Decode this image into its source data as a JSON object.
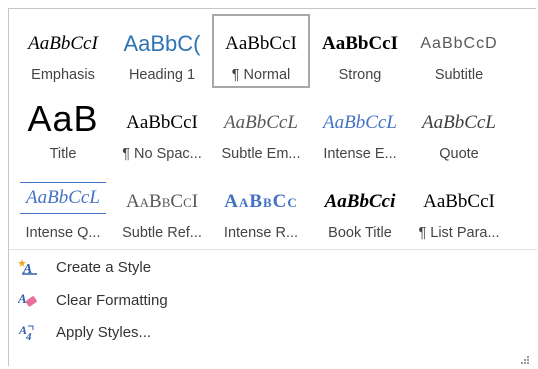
{
  "gallery": {
    "rows": [
      [
        {
          "preview": "AaBbCcI",
          "label": "Emphasis"
        },
        {
          "preview": "AaBbC(",
          "label": "Heading 1"
        },
        {
          "preview": "AaBbCcI",
          "label": "¶ Normal",
          "selected": true
        },
        {
          "preview": "AaBbCcI",
          "label": "Strong"
        },
        {
          "preview": "AaBbCcD",
          "label": "Subtitle"
        }
      ],
      [
        {
          "preview": "AaB",
          "label": "Title"
        },
        {
          "preview": "AaBbCcI",
          "label": "¶ No Spac..."
        },
        {
          "preview": "AaBbCcL",
          "label": "Subtle Em..."
        },
        {
          "preview": "AaBbCcL",
          "label": "Intense E..."
        },
        {
          "preview": "AaBbCcL",
          "label": "Quote"
        }
      ],
      [
        {
          "preview": "AaBbCcL",
          "label": "Intense Q..."
        },
        {
          "preview": "AaBbCcI",
          "label": "Subtle Ref..."
        },
        {
          "preview": "AaBbCc",
          "label": "Intense R..."
        },
        {
          "preview": "AaBbCci",
          "label": "Book Title"
        },
        {
          "preview": "AaBbCcI",
          "label": "¶ List Para..."
        }
      ]
    ]
  },
  "commands": [
    {
      "label": "Create a Style",
      "icon": "create-style-icon"
    },
    {
      "label": "Clear Formatting",
      "icon": "clear-formatting-icon"
    },
    {
      "label": "Apply Styles...",
      "icon": "apply-styles-icon"
    }
  ],
  "colors": {
    "selected_border": "#a8a8a8",
    "heading_blue": "#2e74b5",
    "intense_blue": "#4472c4",
    "label_gray": "#444444",
    "subtle_gray": "#595959"
  }
}
